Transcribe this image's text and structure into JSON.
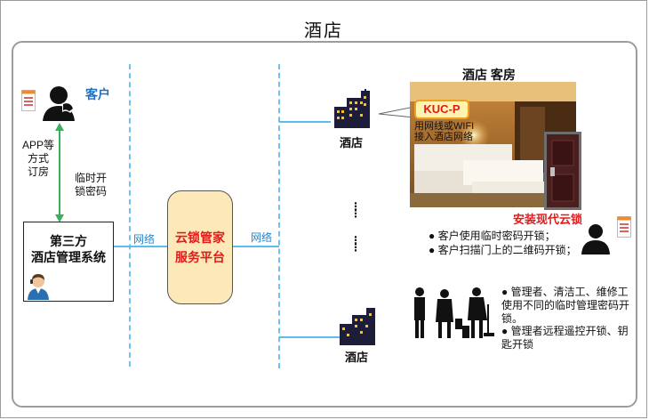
{
  "title": "酒店",
  "customer": {
    "label": "客户"
  },
  "booking": {
    "line1": "APP等",
    "line2": "方式",
    "line3": "订房"
  },
  "temp_code": {
    "line1": "临时开",
    "line2": "锁密码"
  },
  "pms": {
    "line1": "第三方",
    "line2": "酒店管理系统"
  },
  "platform": {
    "line1": "云锁管家",
    "line2": "服务平台"
  },
  "network": {
    "left": "网络",
    "right": "网络"
  },
  "hotel_top": {
    "label": "酒店"
  },
  "hotel_bottom": {
    "label": "酒店"
  },
  "room": {
    "title": "酒店 客房"
  },
  "kuc": {
    "label": "KUC-P",
    "note_line1": "用网线或WIFI",
    "note_line2": "接入酒店网络"
  },
  "lock": {
    "title": "安装现代云锁"
  },
  "guest_bullets": [
    "● 客户使用临时密码开锁；",
    "● 客户扫描门上的二维码开锁；"
  ],
  "staff_bullets": {
    "b1_line1": "● 管理者、清洁工、维修工",
    "b1_line2": "使用不同的临时管理密码开",
    "b1_line3": "锁。",
    "b2_line1": "● 管理者远程遥控开锁、钥",
    "b2_line2": "匙开锁"
  },
  "colors": {
    "accent": "#5bbde9",
    "red": "#e01b1b",
    "platform_fill": "#fde9b7",
    "customer_blue": "#1f6fc0"
  },
  "icons": [
    "phone-user-icon",
    "document-icon",
    "support-agent-icon",
    "building-icon",
    "person-icon",
    "staff-group-icon",
    "door-lock-icon"
  ]
}
